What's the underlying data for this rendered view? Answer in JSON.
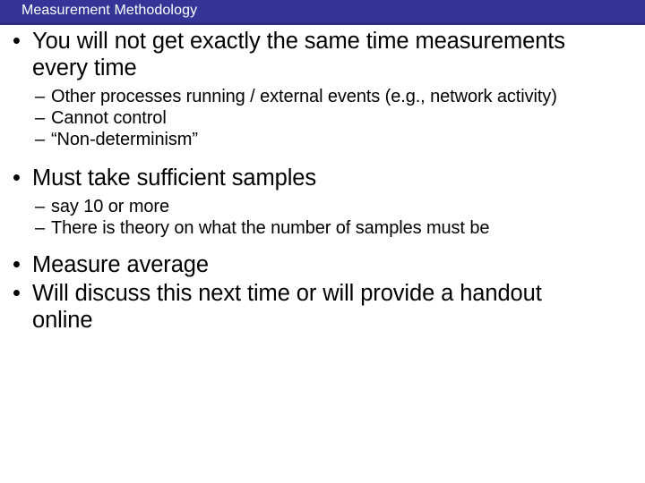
{
  "slide": {
    "title": "Measurement Methodology",
    "title_bar_color": "#343596",
    "title_text_color": "#ffffff",
    "body_text_color": "#000000",
    "background_color": "#ffffff",
    "level1_marker": "•",
    "level2_marker": "–",
    "bullets": [
      {
        "level": 1,
        "text": "You will not get exactly the same time measurements every time"
      },
      {
        "level": 2,
        "text": "Other processes running / external events (e.g., network activity)"
      },
      {
        "level": 2,
        "text": "Cannot control"
      },
      {
        "level": 2,
        "text": "“Non-determinism”"
      },
      {
        "level": 1,
        "text": "Must take sufficient samples"
      },
      {
        "level": 2,
        "text": "say 10 or more"
      },
      {
        "level": 2,
        "text": "There is theory on what the number of samples must be"
      },
      {
        "level": 1,
        "text": "Measure average"
      },
      {
        "level": 1,
        "text": "Will discuss this next time or will provide a handout online"
      }
    ]
  }
}
